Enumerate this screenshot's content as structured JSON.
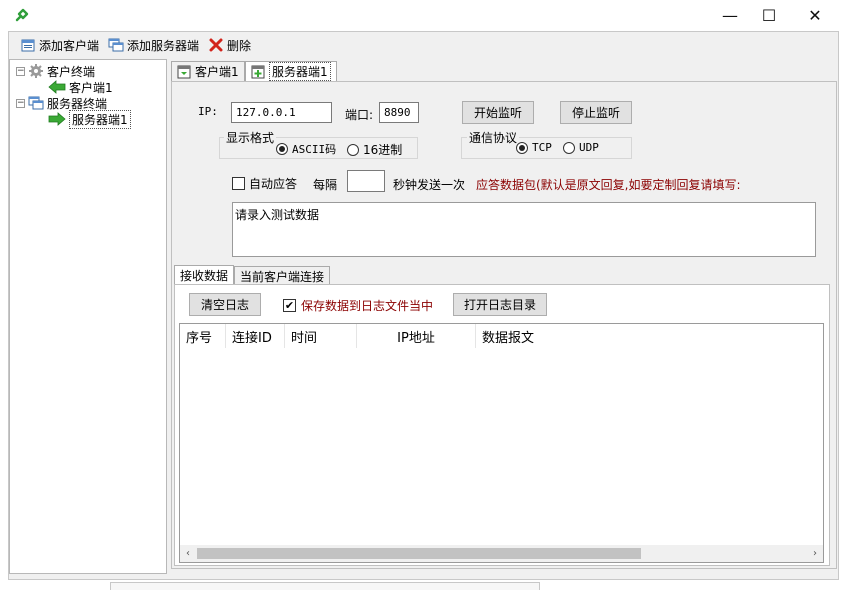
{
  "window": {
    "minimize": "—",
    "maximize": "☐",
    "close": "✕"
  },
  "toolbar": {
    "add_client": "添加客户端",
    "add_server": "添加服务器端",
    "delete": "删除"
  },
  "tree": {
    "clients_root": "客户终端",
    "client_1": "客户端1",
    "servers_root": "服务器终端",
    "server_1": "服务器端1"
  },
  "top_tabs": [
    "客户端1",
    "服务器端1"
  ],
  "server_panel": {
    "ip_label": "IP:",
    "ip_value": "127.0.0.1",
    "port_label": "端口:",
    "port_value": "8890",
    "start_btn": "开始监听",
    "stop_btn": "停止监听",
    "display_format_title": "显示格式",
    "format_ascii": "ASCII码",
    "format_hex": "16进制",
    "protocol_title": "通信协议",
    "proto_tcp": "TCP",
    "proto_udp": "UDP",
    "auto_reply": "自动应答",
    "every": "每隔",
    "interval_value": "",
    "interval_suffix": "秒钟发送一次",
    "reply_hint": "应答数据包(默认是原文回复,如要定制回复请填写:",
    "reply_text": "请录入测试数据",
    "selected_format": "ascii",
    "selected_protocol": "tcp",
    "auto_reply_checked": false
  },
  "lower_tabs": [
    "接收数据",
    "当前客户端连接"
  ],
  "log": {
    "clear_btn": "清空日志",
    "save_to_file": "保存数据到日志文件当中",
    "save_checked": true,
    "open_dir_btn": "打开日志目录",
    "columns": [
      "序号",
      "连接ID",
      "时间",
      "IP地址",
      "数据报文"
    ],
    "rows": []
  },
  "colors": {
    "hint_red": "#8b0000",
    "arrow_green": "#3aa935"
  }
}
